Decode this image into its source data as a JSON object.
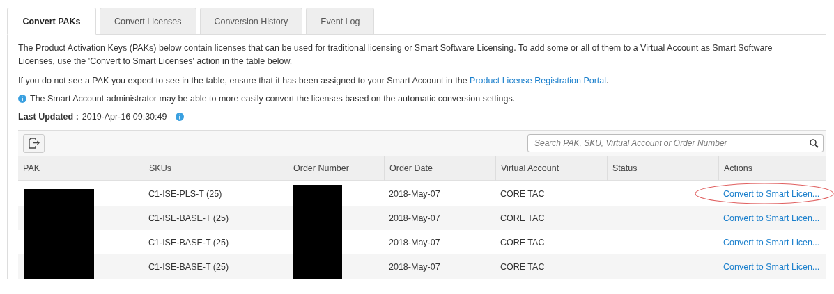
{
  "tabs": [
    {
      "label": "Convert PAKs",
      "selected": true
    },
    {
      "label": "Convert Licenses",
      "selected": false
    },
    {
      "label": "Conversion History",
      "selected": false
    },
    {
      "label": "Event Log",
      "selected": false
    }
  ],
  "intro": "The Product Activation Keys (PAKs) below contain licenses that can be used for traditional licensing or Smart Software Licensing. To add some or all of them to a Virtual Account as Smart Software Licenses, use the 'Convert to Smart Licenses' action in the table below.",
  "assign_note": {
    "text": "If you do not see a PAK you expect to see in the table, ensure that it has been assigned to your Smart Account in the",
    "link": "Product License Registration Portal",
    "after": "."
  },
  "info_note": "The Smart Account administrator may be able to more easily convert the licenses based on the automatic conversion settings.",
  "last_updated": {
    "label": "Last Updated :",
    "value": "2019-Apr-16 09:30:49"
  },
  "search": {
    "placeholder": "Search PAK, SKU, Virtual Account or Order Number"
  },
  "table": {
    "columns": [
      "PAK",
      "SKUs",
      "Order Number",
      "Order Date",
      "Virtual Account",
      "Status",
      "Actions"
    ],
    "rows": [
      {
        "pak_redacted": true,
        "sku": "C1-ISE-PLS-T (25)",
        "order_redacted": true,
        "order_date": "2018-May-07",
        "virtual_account": "CORE TAC",
        "action": "Convert to Smart Licen...",
        "highlighted": true
      },
      {
        "pak_redacted": true,
        "sku": "C1-ISE-BASE-T (25)",
        "order_redacted": true,
        "order_date": "2018-May-07",
        "virtual_account": "CORE TAC",
        "action": "Convert to Smart Licen..."
      },
      {
        "pak_redacted": true,
        "sku": "C1-ISE-BASE-T (25)",
        "order_redacted": true,
        "order_date": "2018-May-07",
        "virtual_account": "CORE TAC",
        "action": "Convert to Smart Licen..."
      },
      {
        "pak_redacted": true,
        "sku": "C1-ISE-BASE-T (25)",
        "order_redacted": true,
        "order_date": "2018-May-07",
        "virtual_account": "CORE TAC",
        "action": "Convert to Smart Licen..."
      }
    ]
  }
}
